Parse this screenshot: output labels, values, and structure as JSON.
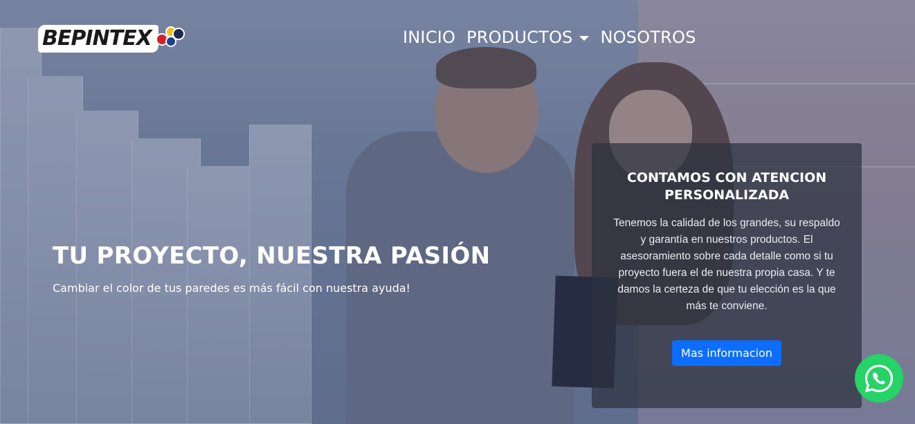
{
  "brand": {
    "logo_text": "BEPINTEX",
    "colors": {
      "accent": "#0d6efd",
      "whatsapp": "#25d366",
      "logo_red": "#d42027",
      "logo_blue": "#1d3f8f",
      "logo_yellow": "#f2c21a"
    }
  },
  "nav": {
    "items": [
      {
        "label": "INICIO"
      },
      {
        "label": "PRODUCTOS",
        "has_dropdown": true
      },
      {
        "label": "NOSOTROS"
      }
    ]
  },
  "hero": {
    "title": "TU PROYECTO, NUESTRA PASIÓN",
    "subtitle": "Cambiar el color de tus paredes es más fácil con nuestra ayuda!"
  },
  "card": {
    "title": "CONTAMOS CON ATENCION PERSONALIZADA",
    "text": "Tenemos la calidad de los grandes, su respaldo y garantía en nuestros productos. El asesoramiento sobre cada detalle como si tu proyecto fuera el de nuestra propia casa. Y te damos la certeza de que tu elección es la que más te conviene.",
    "button_label": "Mas informacion"
  },
  "floating": {
    "whatsapp_icon": "whatsapp-icon"
  }
}
